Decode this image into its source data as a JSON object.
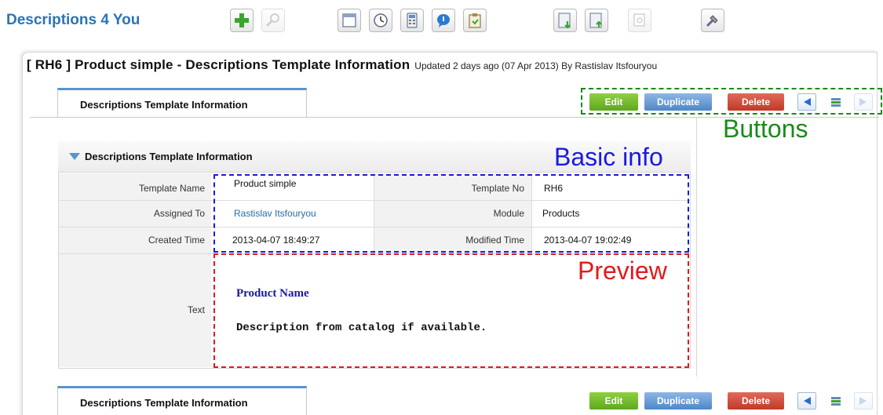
{
  "app": {
    "title": "Descriptions 4 You"
  },
  "toolbar": {
    "icons": [
      "add-icon",
      "search-icon",
      "calendar-icon",
      "clock-icon",
      "calculator-icon",
      "chat-icon",
      "clipboard-icon",
      "import-icon",
      "export-icon",
      "find-duplicates-icon",
      "settings-icon"
    ]
  },
  "record": {
    "title": "[ RH6 ] Product simple - Descriptions Template Information",
    "subtitle": "Updated 2 days ago (07 Apr 2013) By Rastislav Itsfouryou"
  },
  "tabs": {
    "top_label": "Descriptions Template Information",
    "bottom_label": "Descriptions Template Information"
  },
  "actions": {
    "edit": "Edit",
    "duplicate": "Duplicate",
    "delete": "Delete"
  },
  "block": {
    "header": "Descriptions Template Information",
    "fields": {
      "template_name_label": "Template Name",
      "template_name_value": "Product simple",
      "template_no_label": "Template No",
      "template_no_value": "RH6",
      "assigned_to_label": "Assigned To",
      "assigned_to_value": "Rastislav Itsfouryou",
      "module_label": "Module",
      "module_value": "Products",
      "created_time_label": "Created Time",
      "created_time_value": "2013-04-07 18:49:27",
      "modified_time_label": "Modified Time",
      "modified_time_value": "2013-04-07 19:02:49",
      "text_label": "Text"
    },
    "preview": {
      "product_name": "Product Name",
      "description": "Description from catalog if available."
    }
  },
  "annotations": {
    "buttons": "Buttons",
    "basic_info": "Basic info",
    "preview": "Preview"
  },
  "colors": {
    "brand": "#2a74b8",
    "edit": "#5ea820",
    "duplicate": "#4f87c8",
    "delete": "#c03a28",
    "annotation_green": "#1a8a1a",
    "annotation_blue": "#1a1ae0",
    "annotation_red": "#e01a1a"
  }
}
